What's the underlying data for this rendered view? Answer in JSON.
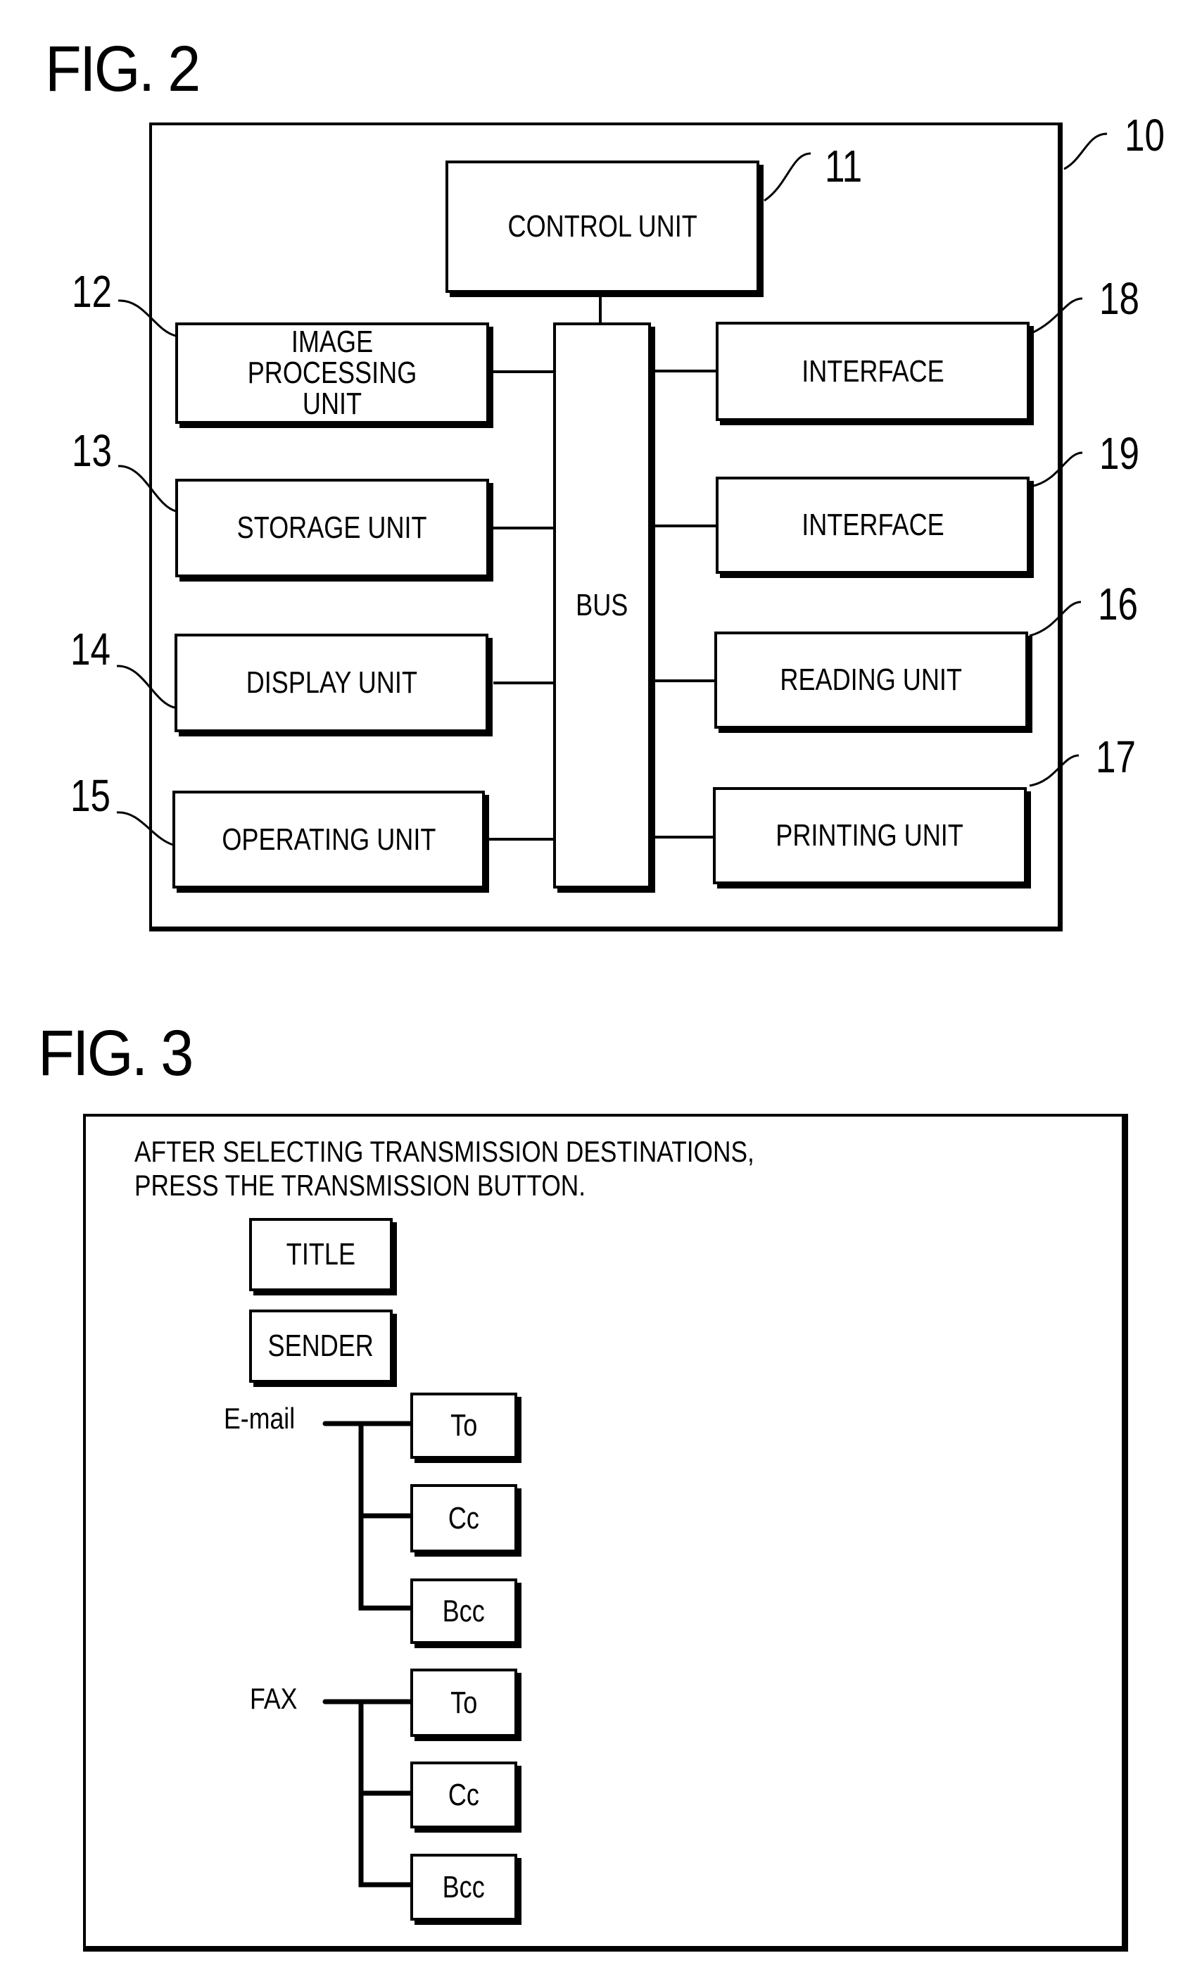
{
  "fig2": {
    "title": "FIG. 2",
    "device_ref": "10",
    "units": {
      "control": {
        "label": "CONTROL UNIT",
        "ref": "11"
      },
      "image_processing": {
        "label": "IMAGE PROCESSING\nUNIT",
        "ref": "12"
      },
      "storage": {
        "label": "STORAGE UNIT",
        "ref": "13"
      },
      "display": {
        "label": "DISPLAY UNIT",
        "ref": "14"
      },
      "operating": {
        "label": "OPERATING UNIT",
        "ref": "15"
      },
      "reading": {
        "label": "READING UNIT",
        "ref": "16"
      },
      "printing": {
        "label": "PRINTING UNIT",
        "ref": "17"
      },
      "interface_18": {
        "label": "INTERFACE",
        "ref": "18"
      },
      "interface_19": {
        "label": "INTERFACE",
        "ref": "19"
      },
      "bus": {
        "label": "BUS"
      }
    }
  },
  "fig3": {
    "title": "FIG. 3",
    "instruction_line1": "AFTER SELECTING TRANSMISSION DESTINATIONS,",
    "instruction_line2": "PRESS THE TRANSMISSION BUTTON.",
    "title_button": "TITLE",
    "sender_button": "SENDER",
    "email": {
      "label": "E-mail",
      "to": "To",
      "cc": "Cc",
      "bcc": "Bcc"
    },
    "fax": {
      "label": "FAX",
      "to": "To",
      "cc": "Cc",
      "bcc": "Bcc"
    }
  }
}
